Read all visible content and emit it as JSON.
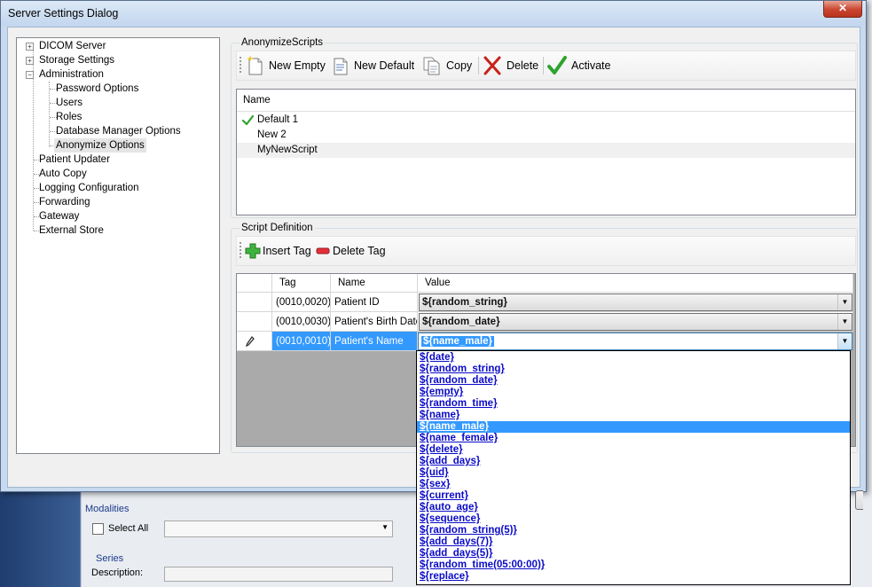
{
  "dialog": {
    "title": "Server Settings Dialog",
    "close_label": "✕"
  },
  "tree": {
    "items": [
      {
        "label": "DICOM Server"
      },
      {
        "label": "Storage Settings"
      },
      {
        "label": "Administration"
      },
      {
        "label": "Password Options"
      },
      {
        "label": "Users"
      },
      {
        "label": "Roles"
      },
      {
        "label": "Database Manager Options"
      },
      {
        "label": "Anonymize Options"
      },
      {
        "label": "Patient Updater"
      },
      {
        "label": "Auto Copy"
      },
      {
        "label": "Logging Configuration"
      },
      {
        "label": "Forwarding"
      },
      {
        "label": "Gateway"
      },
      {
        "label": "External Store"
      }
    ],
    "expanders": {
      "collapsed": "+",
      "expanded": "−"
    }
  },
  "scripts": {
    "group_label": "AnonymizeScripts",
    "toolbar": {
      "new_empty": "New Empty",
      "new_default": "New Default",
      "copy": "Copy",
      "delete": "Delete",
      "activate": "Activate"
    },
    "column_name": "Name",
    "rows": [
      {
        "name": "Default 1",
        "active": true
      },
      {
        "name": "New 2",
        "active": false
      },
      {
        "name": "MyNewScript",
        "active": false
      }
    ]
  },
  "definition": {
    "group_label": "Script Definition",
    "toolbar": {
      "insert_tag": "Insert Tag",
      "delete_tag": "Delete Tag"
    },
    "columns": {
      "tag": "Tag",
      "name": "Name",
      "value": "Value"
    },
    "rows": [
      {
        "tag": "(0010,0020)",
        "name": "Patient ID",
        "value": "${random_string}"
      },
      {
        "tag": "(0010,0030)",
        "name": "Patient's Birth Date",
        "value": "${random_date}"
      },
      {
        "tag": "(0010,0010)",
        "name": "Patient's Name",
        "value": "${name_male}"
      }
    ],
    "editing_row_icon": "pencil-icon"
  },
  "dropdown": {
    "selected": "${name_male}",
    "options": [
      "${date}",
      "${random_string}",
      "${random_date}",
      "${empty}",
      "${random_time}",
      "${name}",
      "${name_male}",
      "${name_female}",
      "${delete}",
      "${add_days}",
      "${uid}",
      "${sex}",
      "${current}",
      "${auto_age}",
      "${sequence}",
      "${random_string(5)}",
      "${add_days(7)}",
      "${add_days(5)}",
      "${random_time(05:00:00)}",
      "${replace}"
    ]
  },
  "background": {
    "modalities_label": "Modalities",
    "select_all_label": "Select All",
    "series_label": "Series",
    "description_label": "Description:"
  },
  "colors": {
    "accent": "#3399ff",
    "link": "#0a0ac8",
    "title_bar": "#c3d6ee"
  }
}
